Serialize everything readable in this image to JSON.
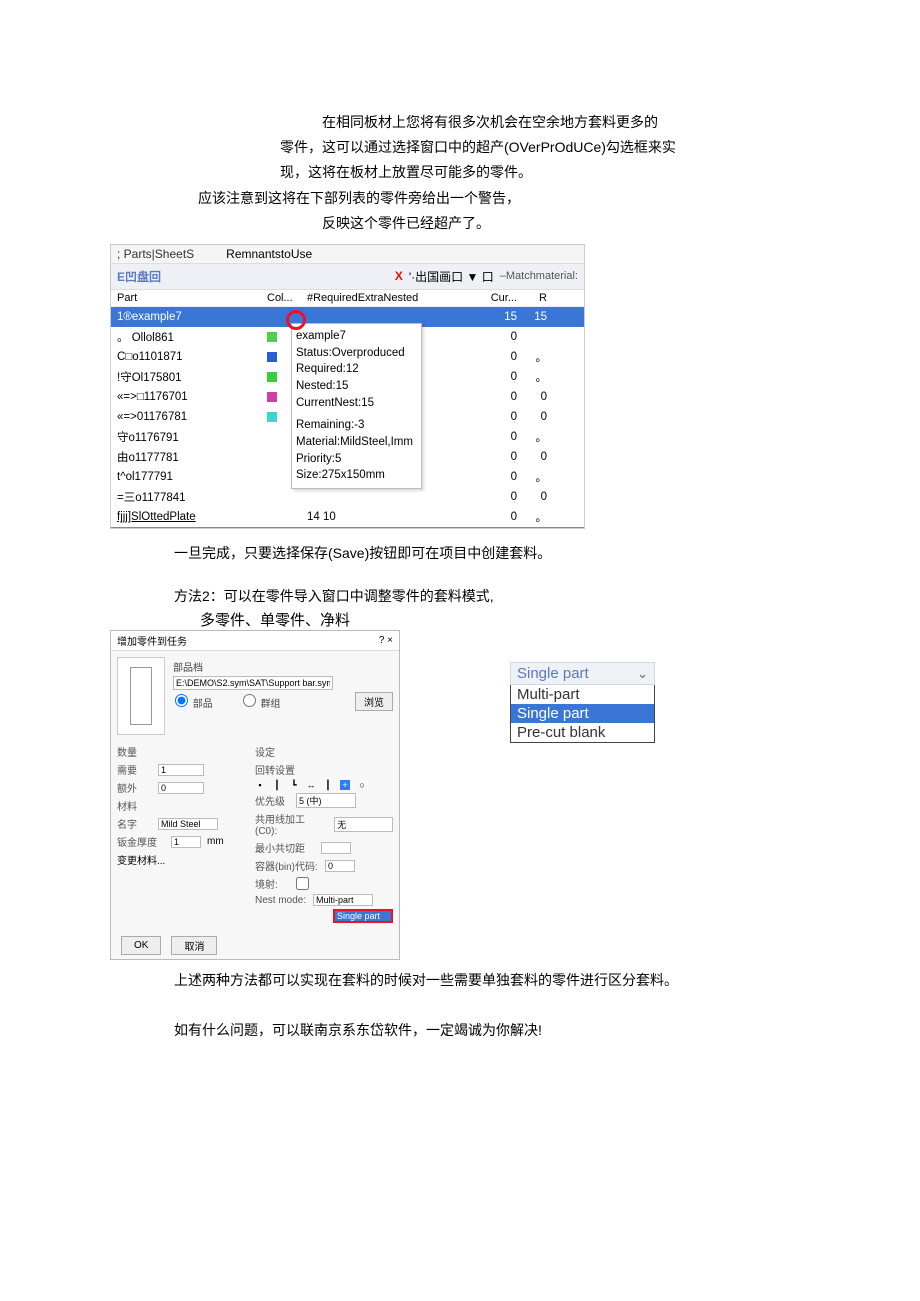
{
  "intro": {
    "l1": "在相同板材上您将有很多次机会在空余地方套料更多的",
    "l2": "零件，这可以通过选择窗口中的超产(OVerPrOdUCe)勾选框来实",
    "l3": "现，这将在板材上放置尽可能多的零件。",
    "l4": "应该注意到这将在下部列表的零件旁给出一个警告，",
    "l5": "反映这个零件已经超产了。"
  },
  "panel": {
    "tabs_label": "; Parts|SheetS",
    "remnants_label": "RemnantstoUse",
    "eppan": "E凹盘回",
    "toolbar_x": "X",
    "toolbar_glyphs": "'·出国画口 ▼ 口",
    "matchmat": "–Matchmaterial:",
    "head": {
      "part": "Part",
      "col": "Col...",
      "req": "#RequiredExtraNested",
      "cur": "Cur...",
      "r": "R"
    },
    "rows": [
      {
        "p": "1®example7",
        "sw": "",
        "cu": "15",
        "r": "15",
        "sel": true
      },
      {
        "p": "。 Ollol861",
        "sw": "#4fd14f",
        "cu": "0",
        "r": ""
      },
      {
        "p": "C□o1101871",
        "sw": "#2b5bd8",
        "cu": "0",
        "r": "。"
      },
      {
        "p": "!守Ol175801",
        "sw": "#38d038",
        "cu": "0",
        "r": "。"
      },
      {
        "p": "«=>□1176701",
        "sw": "#d13fa0",
        "cu": "0",
        "r": "0"
      },
      {
        "p": "«=>01176781",
        "sw": "#3fd3d3",
        "cu": "0",
        "r": "0"
      },
      {
        "p": "守o1176791",
        "sw": "",
        "cu": "0",
        "r": "。"
      },
      {
        "p": "由o1177781",
        "sw": "",
        "cu": "0",
        "r": "0"
      },
      {
        "p": "t^ol177791",
        "sw": "",
        "cu": "0",
        "r": "。"
      },
      {
        "p": "=三o1177841",
        "sw": "",
        "cu": "0",
        "r": "0"
      },
      {
        "p": "fjjj]SlOttedPlate",
        "sw": "",
        "rq": "14        10",
        "cu": "0",
        "r": "。",
        "ul": true
      }
    ]
  },
  "tooltip": {
    "name": "example7",
    "status": "Status:Overproduced",
    "required": "Required:12",
    "nested": "Nested:15",
    "current": "CurrentNest:15",
    "remaining": "Remaining:-3",
    "material": "Material:MildSteel,Imm",
    "priority": "Priority:5",
    "size": "Size:275x150mm"
  },
  "midtext": {
    "done": "一旦完成，只要选择保存(Save)按钮即可在项目中创建套料。",
    "method2a": "方法2：可以在零件导入窗口中调整零件的套料模式,",
    "method2b": "多零件、单零件、净料"
  },
  "dialog": {
    "title": "增加零件到任务",
    "help": "?",
    "close": "×",
    "section_part": "部品档",
    "path": "E:\\DEMO\\S2.sym\\SAT\\Support bar.sym",
    "radio_part": "部品",
    "radio_grp": "群组",
    "btn_browse": "浏览",
    "left": {
      "qty_hdr": "数量",
      "need": "需要",
      "need_v": "1",
      "extra": "额外",
      "extra_v": "0",
      "mat_hdr": "材料",
      "name": "名字",
      "name_v": "Mild Steel",
      "thk": "钣金厚度",
      "thk_v": "1",
      "unit": "mm",
      "btn_change": "变更材料..."
    },
    "right": {
      "settings": "设定",
      "rot": "回转设置",
      "priority": "优先级",
      "priority_v": "5 (中)",
      "shared": "共用线加工 (C0):",
      "shared_v": "无",
      "min": "最小共切距",
      "gap": "容器(bin)代码:",
      "gap_v": "0",
      "mirror": "境射:",
      "nest": "Nest mode:",
      "nest_opt1": "Multi-part",
      "nest_sel": "Single part"
    },
    "ok": "OK",
    "cancel": "取消"
  },
  "dropdown": {
    "current": "Single part",
    "items": [
      "Multi-part",
      "Single part",
      "Pre-cut blank"
    ]
  },
  "closing": {
    "both": "上述两种方法都可以实现在套料的时候对一些需要单独套料的零件进行区分套料。",
    "contact": "如有什么问题，可以联南京系东岱软件，一定竭诚为你解决!"
  }
}
